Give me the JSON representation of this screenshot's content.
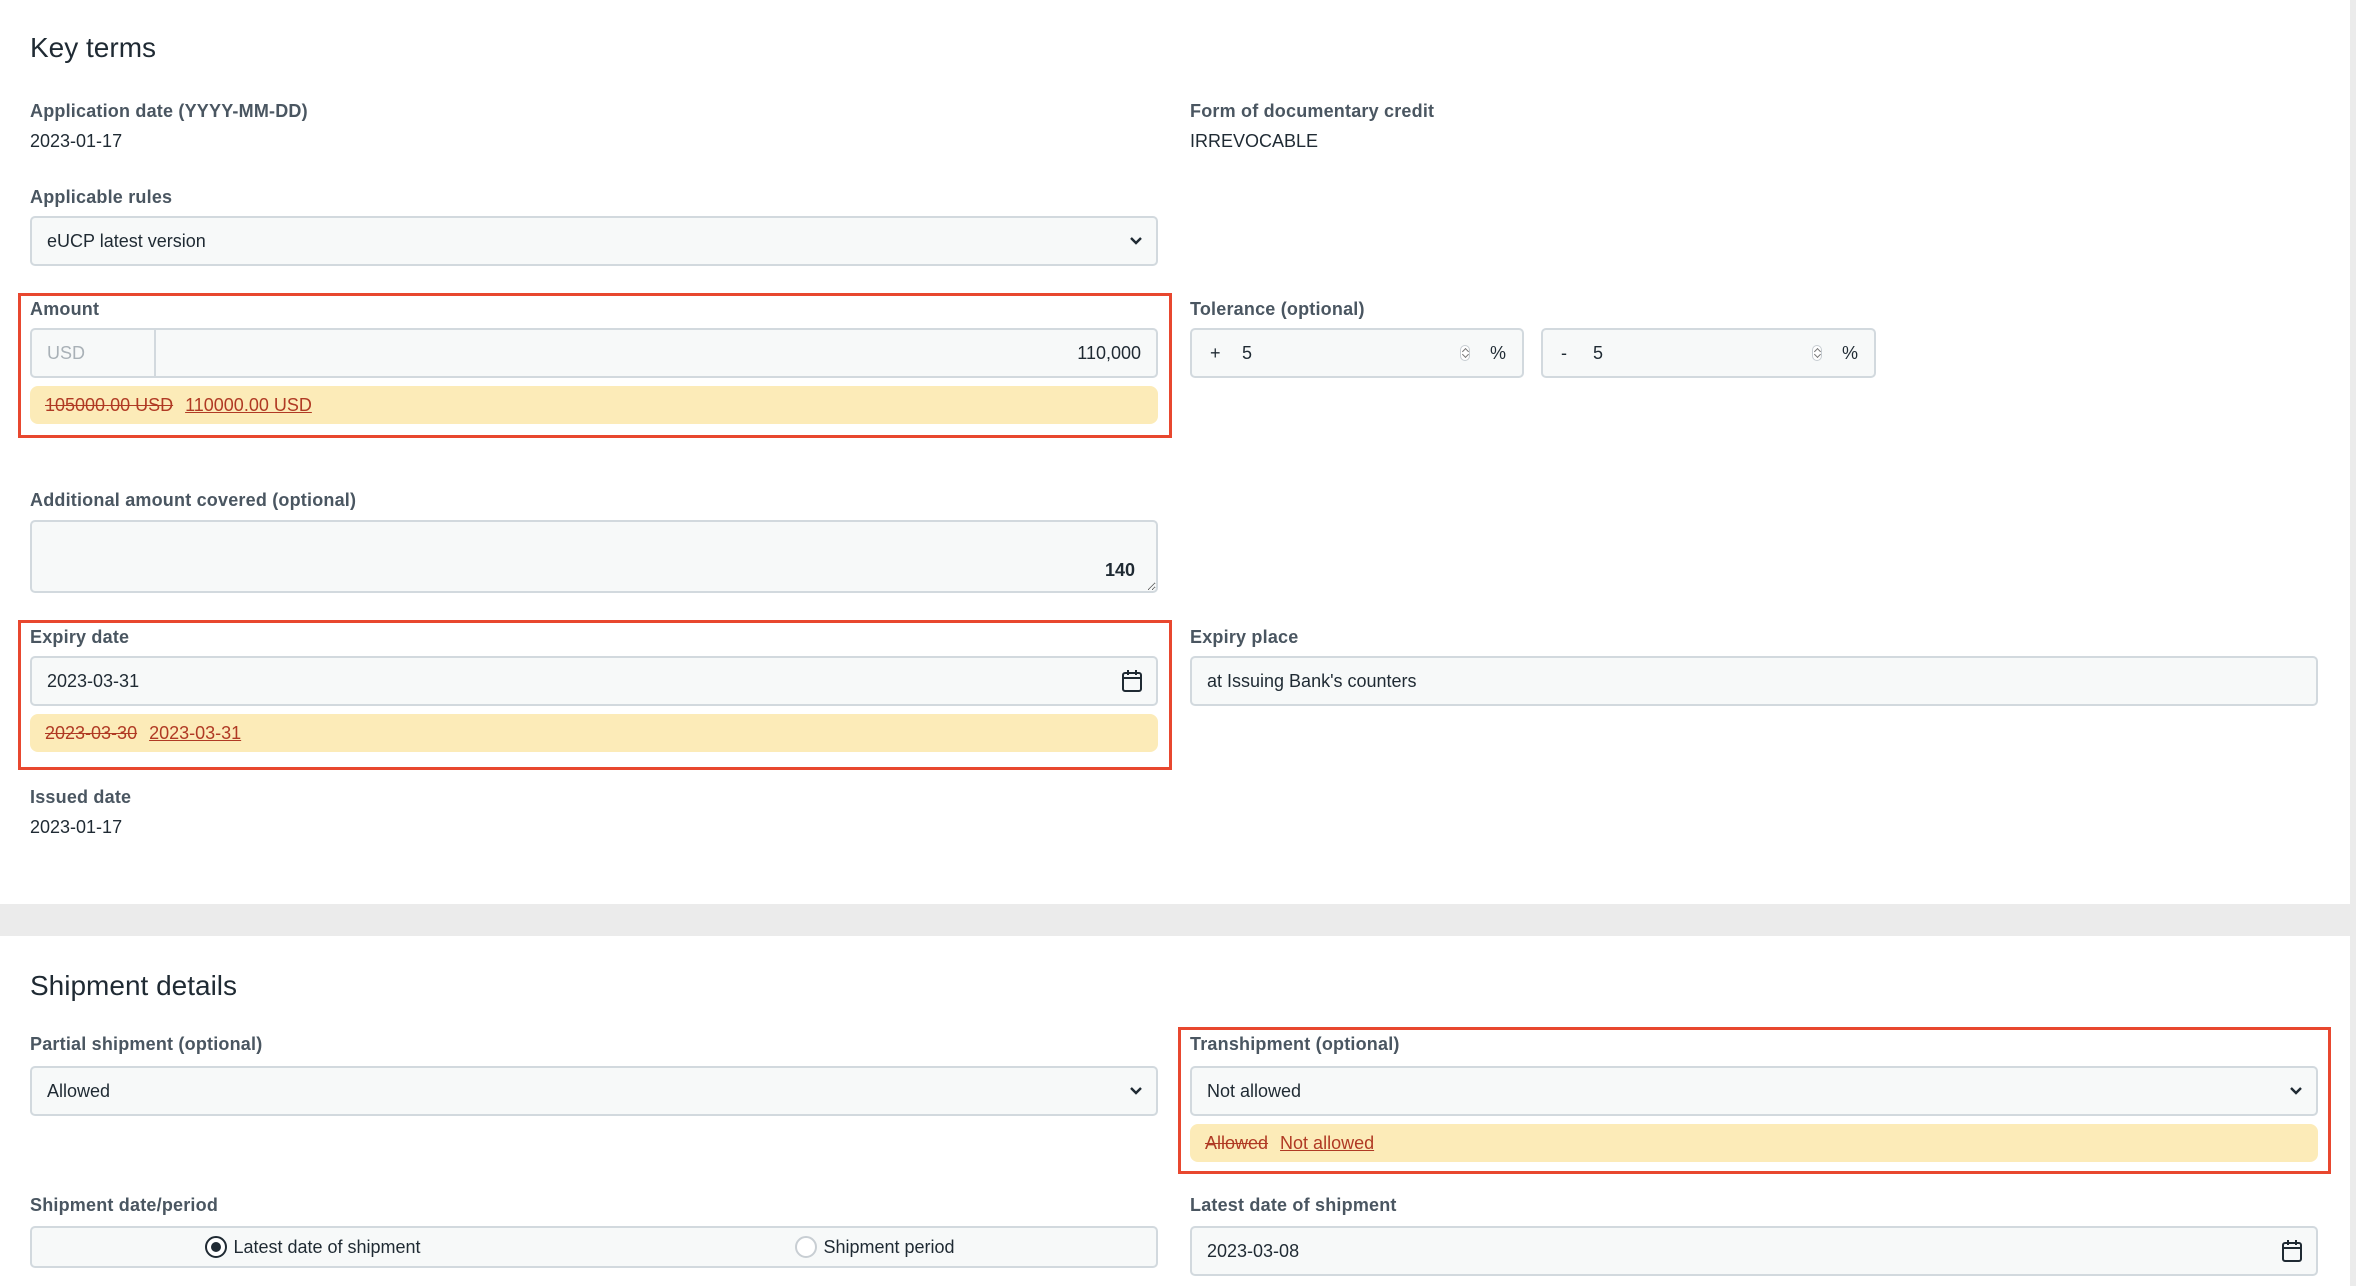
{
  "key_terms": {
    "title": "Key terms",
    "application_date": {
      "label": "Application date (YYYY-MM-DD)",
      "value": "2023-01-17"
    },
    "form_of_credit": {
      "label": "Form of documentary credit",
      "value": "IRREVOCABLE"
    },
    "applicable_rules": {
      "label": "Applicable rules",
      "value": "eUCP latest version"
    },
    "amount": {
      "label": "Amount",
      "currency_placeholder": "USD",
      "value": "110,000",
      "diff_old": "105000.00 USD",
      "diff_new": "110000.00 USD"
    },
    "tolerance": {
      "label": "Tolerance (optional)",
      "plus_sign": "+",
      "plus_value": "5",
      "minus_sign": "-",
      "minus_value": "5",
      "unit": "%"
    },
    "additional_amount": {
      "label": "Additional amount covered (optional)",
      "value": "",
      "char_counter": "140"
    },
    "expiry_date": {
      "label": "Expiry date",
      "value": "2023-03-31",
      "diff_old": "2023-03-30",
      "diff_new": "2023-03-31"
    },
    "expiry_place": {
      "label": "Expiry place",
      "value": "at Issuing Bank's counters"
    },
    "issued_date": {
      "label": "Issued date",
      "value": "2023-01-17"
    }
  },
  "shipment": {
    "title": "Shipment details",
    "partial_shipment": {
      "label": "Partial shipment (optional)",
      "value": "Allowed"
    },
    "transhipment": {
      "label": "Transhipment (optional)",
      "value": "Not allowed",
      "diff_old": "Allowed",
      "diff_new": "Not allowed"
    },
    "date_period": {
      "label": "Shipment date/period",
      "options": [
        {
          "label": "Latest date of shipment",
          "selected": true
        },
        {
          "label": "Shipment period",
          "selected": false
        }
      ]
    },
    "latest_date": {
      "label": "Latest date of shipment",
      "value": "2023-03-08"
    }
  },
  "colors": {
    "highlight_border": "#e8472f",
    "diff_background": "#fcebb8",
    "diff_text": "#b03a24",
    "page_background": "#ebebeb"
  }
}
